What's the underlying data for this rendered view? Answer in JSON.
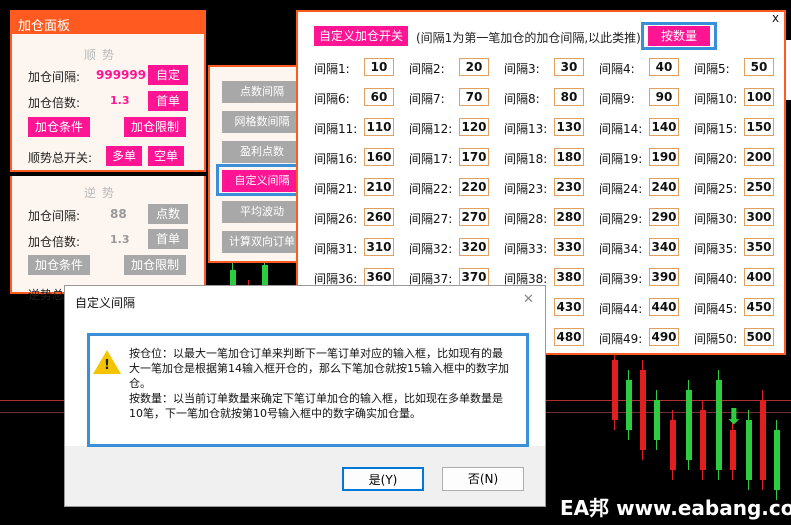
{
  "colors": {
    "accent_pink": "#ff1493",
    "panel_border": "#ff5a1f",
    "highlight_blue": "#3a8fd8"
  },
  "left_panel": {
    "title": "加仓面板",
    "trend_title": "顺势",
    "interval_label": "加仓间隔:",
    "interval_value": "999999",
    "interval_button": "自定",
    "multiple_label": "加仓倍数:",
    "multiple_value": "1.3",
    "multiple_button": "首单",
    "condition_button": "加仓条件",
    "limit_button": "加仓限制",
    "master_switch_label": "顺势总开关:",
    "buy_button": "多单",
    "sell_button": "空单",
    "counter_title": "逆势",
    "counter_interval_label": "加仓间隔:",
    "counter_interval_value": "88",
    "counter_interval_button": "点数",
    "counter_multiple_label": "加仓倍数:",
    "counter_multiple_value": "1.3",
    "counter_multiple_button": "首单",
    "counter_condition_button": "加仓条件",
    "counter_limit_button": "加仓限制",
    "counter_switch_label": "逆势总开"
  },
  "mode_menu": {
    "items": [
      "点数间隔",
      "网格数间隔",
      "盈利点数",
      "自定义间隔",
      "平均波动",
      "计算双向订单"
    ]
  },
  "custom_panel": {
    "toggle_button": "自定义加仓开关",
    "description": "(间隔1为第一笔加仓的加仓间隔,以此类推)",
    "by_quantity_button": "按数量",
    "close": "x",
    "intervals": [
      {
        "label": "间隔1:",
        "value": "10"
      },
      {
        "label": "间隔2:",
        "value": "20"
      },
      {
        "label": "间隔3:",
        "value": "30"
      },
      {
        "label": "间隔4:",
        "value": "40"
      },
      {
        "label": "间隔5:",
        "value": "50"
      },
      {
        "label": "间隔6:",
        "value": "60"
      },
      {
        "label": "间隔7:",
        "value": "70"
      },
      {
        "label": "间隔8:",
        "value": "80"
      },
      {
        "label": "间隔9:",
        "value": "90"
      },
      {
        "label": "间隔10:",
        "value": "100"
      },
      {
        "label": "间隔11:",
        "value": "110"
      },
      {
        "label": "间隔12:",
        "value": "120"
      },
      {
        "label": "间隔13:",
        "value": "130"
      },
      {
        "label": "间隔14:",
        "value": "140"
      },
      {
        "label": "间隔15:",
        "value": "150"
      },
      {
        "label": "间隔16:",
        "value": "160"
      },
      {
        "label": "间隔17:",
        "value": "170"
      },
      {
        "label": "间隔18:",
        "value": "180"
      },
      {
        "label": "间隔19:",
        "value": "190"
      },
      {
        "label": "间隔20:",
        "value": "200"
      },
      {
        "label": "间隔21:",
        "value": "210"
      },
      {
        "label": "间隔22:",
        "value": "220"
      },
      {
        "label": "间隔23:",
        "value": "230"
      },
      {
        "label": "间隔24:",
        "value": "240"
      },
      {
        "label": "间隔25:",
        "value": "250"
      },
      {
        "label": "间隔26:",
        "value": "260"
      },
      {
        "label": "间隔27:",
        "value": "270"
      },
      {
        "label": "间隔28:",
        "value": "280"
      },
      {
        "label": "间隔29:",
        "value": "290"
      },
      {
        "label": "间隔30:",
        "value": "300"
      },
      {
        "label": "间隔31:",
        "value": "310"
      },
      {
        "label": "间隔32:",
        "value": "320"
      },
      {
        "label": "间隔33:",
        "value": "330"
      },
      {
        "label": "间隔34:",
        "value": "340"
      },
      {
        "label": "间隔35:",
        "value": "350"
      },
      {
        "label": "间隔36:",
        "value": "360"
      },
      {
        "label": "间隔37:",
        "value": "370"
      },
      {
        "label": "间隔38:",
        "value": "380"
      },
      {
        "label": "间隔39:",
        "value": "390"
      },
      {
        "label": "间隔40:",
        "value": "400"
      },
      {
        "label": "",
        "value": ""
      },
      {
        "label": "",
        "value": ""
      },
      {
        "label": "",
        "value": "430"
      },
      {
        "label": "间隔44:",
        "value": "440"
      },
      {
        "label": "间隔45:",
        "value": "450"
      },
      {
        "label": "",
        "value": ""
      },
      {
        "label": "",
        "value": ""
      },
      {
        "label": "",
        "value": "480"
      },
      {
        "label": "间隔49:",
        "value": "490"
      },
      {
        "label": "间隔50:",
        "value": "500"
      }
    ]
  },
  "dialog": {
    "title": "自定义间隔",
    "close": "✕",
    "message_1": "按仓位：以最大一笔加仓订单来判断下一笔订单对应的输入框，比如现有的最大一笔加仓是根据第14输入框开仓的，那么下笔加仓就按15输入框中的数字加仓。",
    "message_2": "按数量：以当前订单数量来确定下笔订单加仓的输入框，比如现在多单数量是10笔，下一笔加仓就按第10号输入框中的数字确实加仓量。",
    "yes_button": "是(Y)",
    "no_button": "否(N)"
  },
  "watermark": "EA邦 www.eabang.com"
}
